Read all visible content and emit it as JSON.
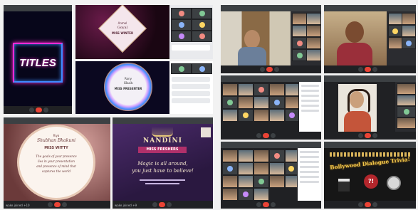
{
  "panels": {
    "p1": {
      "title_text": "TITLES"
    },
    "p2": {
      "lines": [
        "Anmol",
        "Goyal",
        "MISS WINTER"
      ]
    },
    "p3": {
      "lines": [
        "Rony",
        "Shah",
        "MISS PRESENTER"
      ]
    },
    "p4": {
      "title_text": "",
      "lines": [
        "Riya",
        "Shubhan Bhakuni",
        "MISS WITTY",
        "The goals of your presence",
        "lies in your presentation",
        "and presence of mind that",
        "captures the world"
      ]
    },
    "p5": {
      "lines": [
        "NANDINI",
        "MISS FRESHERS",
        "Magic is all around,",
        "you just have to believe!"
      ]
    },
    "p10": {
      "title": "Bollywood Dialogue Trivia!"
    }
  },
  "bottom_text": {
    "p4": "wake joined +10",
    "p5": "wake joined +9"
  },
  "colors": {
    "meet_bg": "#202124",
    "neon_pink": "#ff2bd6",
    "neon_blue": "#3d8bff",
    "end_call": "#ea4335"
  }
}
